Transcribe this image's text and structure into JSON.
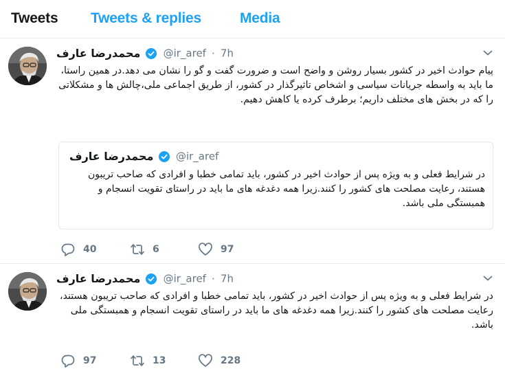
{
  "tabs": [
    {
      "label": "Tweets"
    },
    {
      "label": "Tweets & replies"
    },
    {
      "label": "Media"
    }
  ],
  "colors": {
    "accent": "#1da1f2",
    "muted": "#657786",
    "text": "#14171a",
    "border": "#e6ecf0"
  },
  "tweets": [
    {
      "author": {
        "name": "محمدرضا عارف",
        "handle": "@ir_aref"
      },
      "separator": "·",
      "time": "7h",
      "text": "پیام حوادث اخیر در کشور بسیار روشن و واضح است و ضرورت گفت و گو را نشان می دهد.در همین راستا، ما باید به واسطه جریانات سیاسی و اشخاص تاثیرگذار در کشور، از طریق اجماعی ملی،چالش ها و مشکلاتی را که در بخش های مختلف داریم؛ برطرف کرده یا کاهش دهیم.",
      "quote": {
        "author": {
          "name": "محمدرضا عارف",
          "handle": "@ir_aref"
        },
        "text": "در شرایط فعلی و به ویژه پس از حوادث اخیر در کشور، باید تمامی خطبا و افرادی که صاحب تریبون هستند، رعایت مصلحت های کشور را کنند.زیرا همه دغدغه های ما باید در راستای تقویت انسجام و همبستگی ملی باشد."
      },
      "stats": {
        "replies": "40",
        "retweets": "6",
        "likes": "97"
      }
    },
    {
      "author": {
        "name": "محمدرضا عارف",
        "handle": "@ir_aref"
      },
      "separator": "·",
      "time": "7h",
      "text": "در شرایط فعلی و به ویژه پس از حوادث اخیر در کشور، باید تمامی خطبا و افرادی که صاحب تریبون هستند، رعایت مصلحت های کشور را کنند.زیرا همه دغدغه های ما باید در راستای تقویت انسجام و همبستگی ملی باشد.",
      "stats": {
        "replies": "97",
        "retweets": "13",
        "likes": "228"
      }
    }
  ],
  "icons": {
    "verified": "verified-badge-icon",
    "caret": "chevron-down-icon",
    "reply": "reply-icon",
    "retweet": "retweet-icon",
    "like": "heart-icon"
  }
}
